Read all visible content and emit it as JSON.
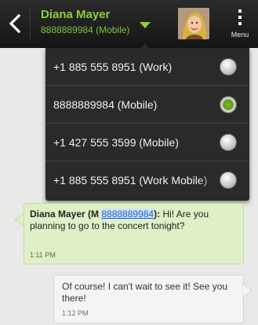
{
  "header": {
    "contact_name": "Diana Mayer",
    "contact_number": "8888889984 (Mobile)",
    "menu_label": "Menu",
    "accent_color": "#8fce3b"
  },
  "number_picker": {
    "options": [
      {
        "label": "+1 885 555 8951 (Work)",
        "selected": false
      },
      {
        "label": "8888889984 (Mobile)",
        "selected": true
      },
      {
        "label": "+1 427 555 3599 (Mobile)",
        "selected": false
      },
      {
        "label": "+1 885 555 8951 (Work Mobile)",
        "selected": false
      }
    ]
  },
  "messages": {
    "incoming": {
      "sender": "Diana Mayer (M ",
      "sender_number": "8888889984",
      "sender_end": "):",
      "text": " Hi! Are you planning to go to the concert tonight?",
      "time": "1:11 PM"
    },
    "outgoing": {
      "text": "Of course! I can't wait to see it! See you there!",
      "time": "1:12 PM"
    }
  },
  "icons": {
    "back": "chevron-left-icon",
    "dropdown": "triangle-down-icon",
    "menu": "vertical-dots-icon",
    "radio": "radio-button-icon"
  }
}
